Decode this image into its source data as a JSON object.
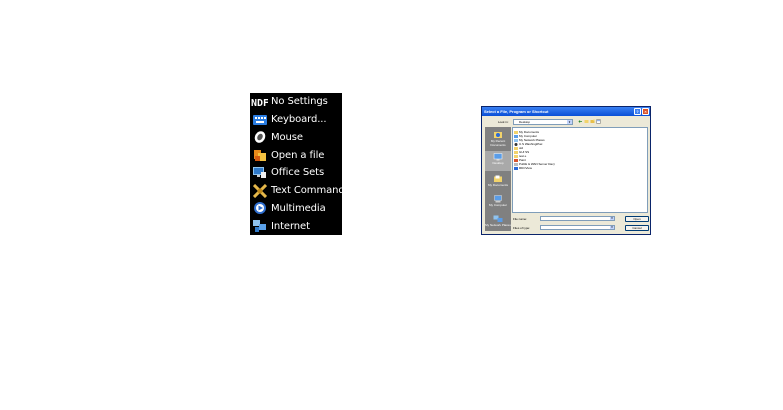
{
  "menu": {
    "items": [
      {
        "label": "No Settings",
        "icon": "ndf-icon"
      },
      {
        "label": "Keyboard...",
        "icon": "keyboard-icon"
      },
      {
        "label": "Mouse",
        "icon": "mouse-icon"
      },
      {
        "label": "Open a file",
        "icon": "open-file-icon"
      },
      {
        "label": "Office Sets",
        "icon": "office-sets-icon"
      },
      {
        "label": "Text Commands",
        "icon": "text-commands-icon"
      },
      {
        "label": "Multimedia",
        "icon": "multimedia-icon"
      },
      {
        "label": "Internet",
        "icon": "internet-icon"
      }
    ]
  },
  "dialog": {
    "title": "Select a File, Program or Shortcut",
    "look_in_label": "Look in:",
    "look_in_value": "Desktop",
    "places": [
      {
        "label": "My Recent Documents"
      },
      {
        "label": "Desktop"
      },
      {
        "label": "My Documents"
      },
      {
        "label": "My Computer"
      },
      {
        "label": "My Network Places"
      }
    ],
    "files": [
      "My Documents",
      "My Computer",
      "My Network Places",
      "U.S WashingtPac",
      "old",
      "GUI SS",
      "test e",
      "Paint",
      "Publik & WAN Server Dav)",
      "RDCView"
    ],
    "file_name_label": "File name:",
    "file_name_value": "",
    "files_of_type_label": "Files of type:",
    "files_of_type_value": "",
    "open_label": "Open",
    "cancel_label": "Cancel"
  },
  "colors": {
    "menu_bg": "#000000",
    "menu_text": "#ffffff",
    "titlebar": "#0a4fd6",
    "dialog_bg": "#ece9d8"
  }
}
